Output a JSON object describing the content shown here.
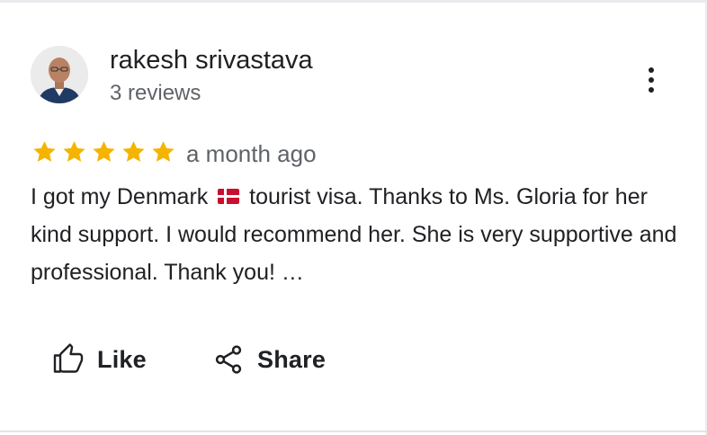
{
  "review": {
    "author_name": "rakesh srivastava",
    "author_reviews": "3 reviews",
    "rating": 5,
    "rating_max": 5,
    "time": "a month ago",
    "text_before_flag": "I got my Denmark ",
    "flag_icon": "denmark-flag-icon",
    "text_after_flag": " tourist visa. Thanks to Ms. Gloria for her kind support. I would recommend her. She is very supportive and professional. Thank you! …"
  },
  "actions": {
    "like_label": "Like",
    "share_label": "Share"
  },
  "icons": {
    "more": "more-vert-icon",
    "like": "thumb-up-icon",
    "share": "share-icon",
    "star": "star-icon"
  },
  "colors": {
    "star": "#f4b400",
    "text": "#202124",
    "secondary_text": "#5f6368",
    "flag_red": "#c8102e"
  }
}
